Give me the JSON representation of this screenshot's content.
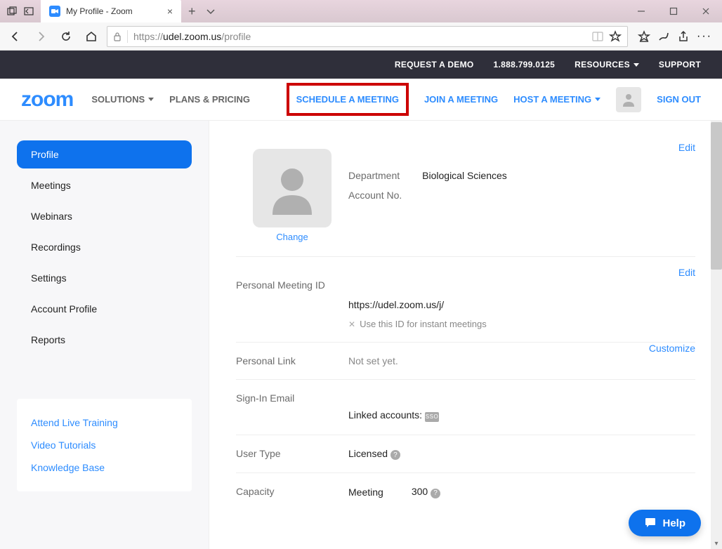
{
  "window": {
    "tab_title": "My Profile - Zoom"
  },
  "browser": {
    "url_prefix": "https://",
    "url_host": "udel.zoom.us",
    "url_path": "/profile"
  },
  "topdark": {
    "request_demo": "REQUEST A DEMO",
    "phone": "1.888.799.0125",
    "resources": "RESOURCES",
    "support": "SUPPORT"
  },
  "mainnav": {
    "logo": "zoom",
    "solutions": "SOLUTIONS",
    "plans": "PLANS & PRICING",
    "schedule": "SCHEDULE A MEETING",
    "join": "JOIN A MEETING",
    "host": "HOST A MEETING",
    "signout": "SIGN OUT"
  },
  "sidebar": {
    "items": [
      {
        "label": "Profile"
      },
      {
        "label": "Meetings"
      },
      {
        "label": "Webinars"
      },
      {
        "label": "Recordings"
      },
      {
        "label": "Settings"
      },
      {
        "label": "Account Profile"
      },
      {
        "label": "Reports"
      }
    ],
    "help": {
      "training": "Attend Live Training",
      "tutorials": "Video Tutorials",
      "kb": "Knowledge Base"
    }
  },
  "profile": {
    "change": "Change",
    "department_label": "Department",
    "department_value": "Biological Sciences",
    "account_no_label": "Account No.",
    "account_no_value": "",
    "edit": "Edit",
    "pmi_label": "Personal Meeting ID",
    "pmi_url": "https://udel.zoom.us/j/",
    "pmi_instant": "Use this ID for instant meetings",
    "personal_link_label": "Personal Link",
    "personal_link_value": "Not set yet.",
    "customize": "Customize",
    "signin_label": "Sign-In Email",
    "linked_accounts": "Linked accounts:",
    "usertype_label": "User Type",
    "usertype_value": "Licensed",
    "capacity_label": "Capacity",
    "capacity_meeting": "Meeting",
    "capacity_value": "300"
  },
  "help_fab": "Help"
}
